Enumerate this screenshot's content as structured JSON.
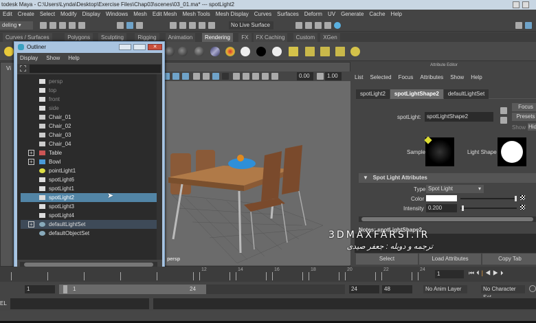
{
  "window": {
    "title": "todesk Maya - C:\\Users\\Lynda\\Desktop\\Exercise Files\\Chap03\\scenes\\03_01.ma*  ---  spotLight2"
  },
  "menu": [
    "Edit",
    "Create",
    "Select",
    "Modify",
    "Display",
    "Windows",
    "Mesh",
    "Edit Mesh",
    "Mesh Tools",
    "Mesh Display",
    "Curves",
    "Surfaces",
    "Deform",
    "UV",
    "Generate",
    "Cache",
    "Help"
  ],
  "status": {
    "mode": "deling",
    "live_surface": "No Live Surface"
  },
  "shelf_tabs": [
    "Curves / Surfaces",
    "Polygons",
    "Sculpting",
    "Rigging",
    "Animation",
    "Rendering",
    "FX",
    "FX Caching",
    "Custom",
    "XGen"
  ],
  "shelf_active": "Rendering",
  "viewport": {
    "menu_label": "Vi",
    "camera": "persp",
    "value1": "0.00",
    "value2": "1.00"
  },
  "outliner": {
    "title": "Outliner",
    "menu": [
      "Display",
      "Show",
      "Help"
    ],
    "items": [
      {
        "label": "persp",
        "icon": "camera-icon",
        "dim": true
      },
      {
        "label": "top",
        "icon": "camera-icon",
        "dim": true
      },
      {
        "label": "front",
        "icon": "camera-icon",
        "dim": true
      },
      {
        "label": "side",
        "icon": "camera-icon",
        "dim": true
      },
      {
        "label": "Chair_01",
        "icon": "group-icon"
      },
      {
        "label": "Chair_02",
        "icon": "group-icon"
      },
      {
        "label": "Chair_03",
        "icon": "group-icon"
      },
      {
        "label": "Chair_04",
        "icon": "group-icon"
      },
      {
        "label": "Table",
        "icon": "mesh-icon",
        "expand": true
      },
      {
        "label": "Bowl",
        "icon": "mesh-icon",
        "expand": true
      },
      {
        "label": "pointLight1",
        "icon": "point-light-icon"
      },
      {
        "label": "spotLight6",
        "icon": "spot-light-icon"
      },
      {
        "label": "spotLight1",
        "icon": "spot-light-icon"
      },
      {
        "label": "spotLight2",
        "icon": "spot-light-icon",
        "selected": true
      },
      {
        "label": "spotLight3",
        "icon": "spot-light-icon"
      },
      {
        "label": "spotLight4",
        "icon": "spot-light-icon"
      },
      {
        "label": "defaultLightSet",
        "icon": "set-icon",
        "expand": true,
        "highlight": true
      },
      {
        "label": "defaultObjectSet",
        "icon": "set-icon"
      }
    ]
  },
  "attribute_editor": {
    "title": "Attribute Editor",
    "menu": [
      "List",
      "Selected",
      "Focus",
      "Attributes",
      "Show",
      "Help"
    ],
    "tabs": [
      "spotLight2",
      "spotLightShape2",
      "defaultLightSet"
    ],
    "active_tab": "spotLightShape2",
    "node_label": "spotLight:",
    "node_value": "spotLightShape2",
    "focus": "Focus",
    "presets": "Presets",
    "show": "Show",
    "hide": "Hid",
    "sample": "Sample",
    "light_shape": "Light Shape",
    "section": "Spot Light Attributes",
    "type_label": "Type",
    "type_value": "Spot Light",
    "color_label": "Color",
    "intensity_label": "Intensity",
    "intensity_value": "0.200",
    "intensity_fraction": 0.02,
    "notes": "Notes:  spotLightShape2",
    "buttons": [
      "Select",
      "Load Attributes",
      "Copy Tab"
    ]
  },
  "watermark": {
    "site": "3DMAXFARSI.IR",
    "credit": "ترجمه و دوبله : جعفر صیدی"
  },
  "timeline": {
    "ticks": [
      "12",
      "14",
      "16",
      "18",
      "20",
      "22",
      "24"
    ],
    "current_frame": "1"
  },
  "range": {
    "start": "1",
    "slider_start": "1",
    "slider_end": "24",
    "end": "24",
    "max": "48",
    "anim_layer": "No Anim Layer",
    "character_set": "No Character Set"
  },
  "cmd": {
    "label": "EL"
  }
}
